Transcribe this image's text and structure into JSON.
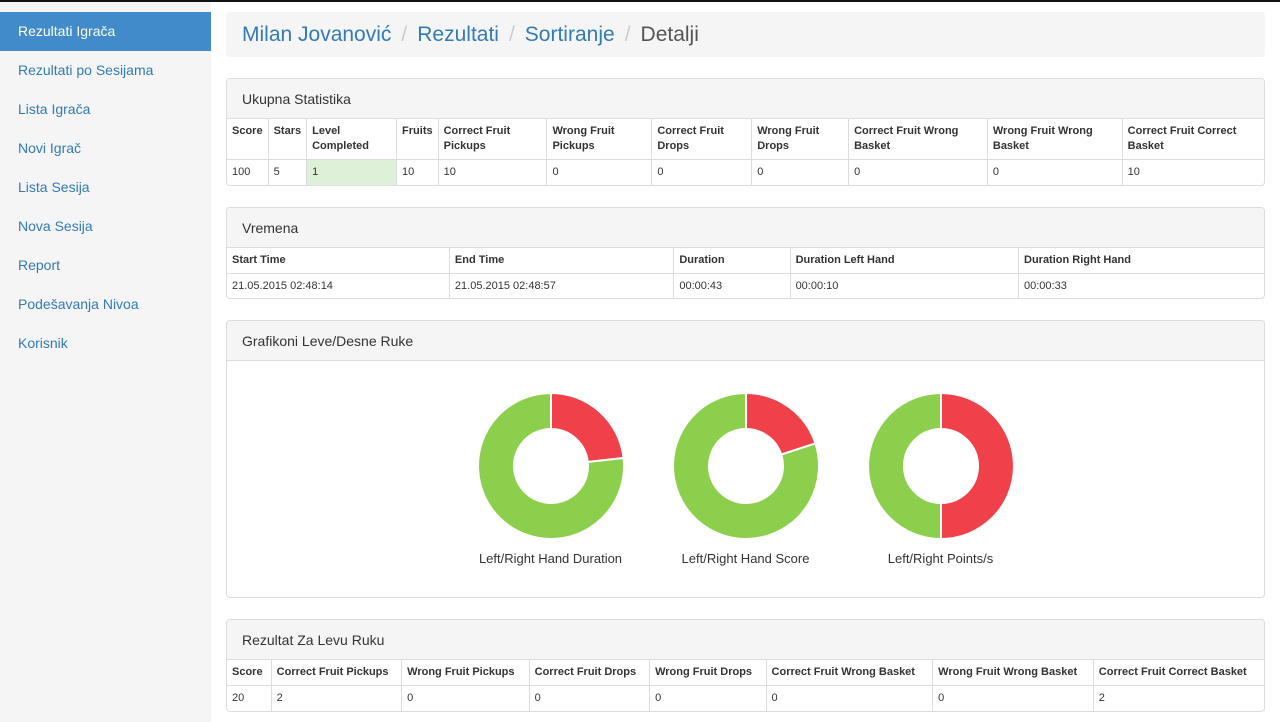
{
  "sidebar": {
    "items": [
      {
        "label": "Rezultati Igrača",
        "active": true
      },
      {
        "label": "Rezultati po Sesijama"
      },
      {
        "label": "Lista Igrača"
      },
      {
        "label": "Novi Igrač"
      },
      {
        "label": "Lista Sesija"
      },
      {
        "label": "Nova Sesija"
      },
      {
        "label": "Report"
      },
      {
        "label": "Podešavanja Nivoa"
      },
      {
        "label": "Korisnik"
      }
    ]
  },
  "breadcrumb": [
    "Milan Jovanović",
    "Rezultati",
    "Sortiranje",
    "Detalji"
  ],
  "stats": {
    "title": "Ukupna Statistika",
    "headers": [
      "Score",
      "Stars",
      "Level Completed",
      "Fruits",
      "Correct Fruit Pickups",
      "Wrong Fruit Pickups",
      "Correct Fruit Drops",
      "Wrong Fruit Drops",
      "Correct Fruit Wrong Basket",
      "Wrong Fruit Wrong Basket",
      "Correct Fruit Correct Basket"
    ],
    "row": [
      "100",
      "5",
      "1",
      "10",
      "10",
      "0",
      "0",
      "0",
      "0",
      "0",
      "10"
    ]
  },
  "times": {
    "title": "Vremena",
    "headers": [
      "Start Time",
      "End Time",
      "Duration",
      "Duration Left Hand",
      "Duration Right Hand"
    ],
    "row": [
      "21.05.2015 02:48:14",
      "21.05.2015 02:48:57",
      "00:00:43",
      "00:00:10",
      "00:00:33"
    ]
  },
  "charts_panel": {
    "title": "Grafikoni Leve/Desne Ruke"
  },
  "chart_data": [
    {
      "type": "pie",
      "donut": true,
      "title": "Left/Right Hand Duration",
      "values": [
        10,
        33
      ],
      "colors": [
        "#f0404a",
        "#8bcf4d"
      ]
    },
    {
      "type": "pie",
      "donut": true,
      "title": "Left/Right Hand Score",
      "values": [
        20,
        80
      ],
      "colors": [
        "#f0404a",
        "#8bcf4d"
      ]
    },
    {
      "type": "pie",
      "donut": true,
      "title": "Left/Right Points/s",
      "values": [
        1,
        1
      ],
      "colors": [
        "#f0404a",
        "#8bcf4d"
      ]
    }
  ],
  "left": {
    "title": "Rezultat Za Levu Ruku",
    "headers": [
      "Score",
      "Correct Fruit Pickups",
      "Wrong Fruit Pickups",
      "Correct Fruit Drops",
      "Wrong Fruit Drops",
      "Correct Fruit Wrong Basket",
      "Wrong Fruit Wrong Basket",
      "Correct Fruit Correct Basket"
    ],
    "row": [
      "20",
      "2",
      "0",
      "0",
      "0",
      "0",
      "0",
      "2"
    ]
  }
}
